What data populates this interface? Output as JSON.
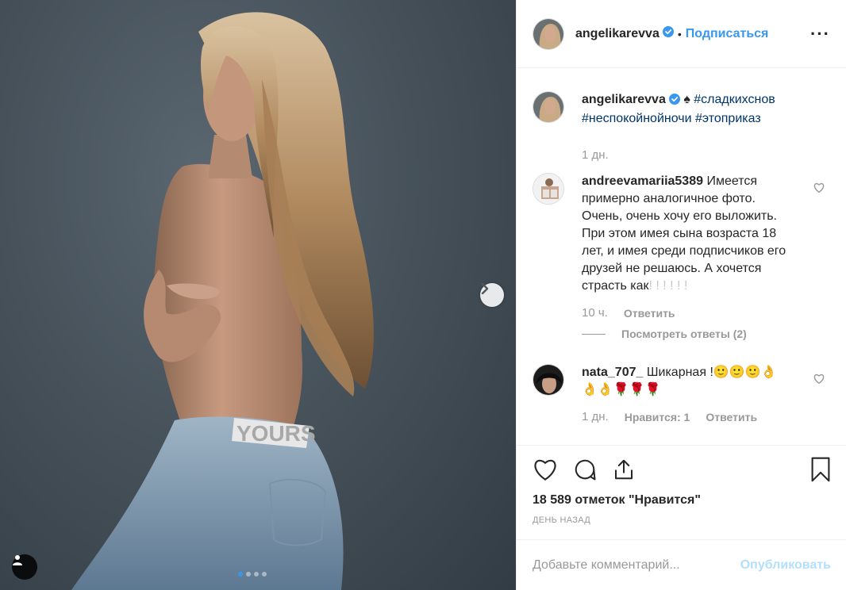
{
  "post": {
    "author": "angelikarevva",
    "follow_label": "Подписаться",
    "separator": "•",
    "more_label": "···",
    "photo_waist_text": "YOURS",
    "carousel_count": 4,
    "carousel_active": 1
  },
  "caption": {
    "username": "angelikarevva",
    "text_symbol": "♠",
    "hashtags": [
      "#сладкихснов",
      "#неспокойнойночи",
      "#этоприказ"
    ],
    "time": "1 дн."
  },
  "comments": [
    {
      "username": "andreevamariia5389",
      "text": "Имеется примерно аналогичное фото. Очень, очень хочу его выложить. При этом имея сына возраста 18 лет, и имея среди подписчиков его друзей не решаюсь. А хочется страсть как",
      "cut_text": "! ! ! ! ! !",
      "time": "10 ч.",
      "reply_label": "Ответить",
      "view_replies": "Посмотреть ответы (2)"
    },
    {
      "username": "nata_707_",
      "text": "Шикарная !🙂🙂🙂👌👌👌🌹🌹🌹",
      "time": "1 дн.",
      "likes_label": "Нравится: 1",
      "reply_label": "Ответить"
    }
  ],
  "actions": {
    "likes_text": "18 589 отметок \"Нравится\"",
    "date": "ДЕНЬ НАЗАД"
  },
  "add_comment": {
    "placeholder": "Добавьте комментарий...",
    "publish_label": "Опубликовать"
  },
  "colors": {
    "accent": "#3897f0",
    "hashtag": "#003569",
    "muted": "#999999",
    "publish_disabled": "#b2dffc"
  },
  "icons": [
    "person-tag-icon",
    "chevron-right-icon",
    "verified-badge-icon",
    "more-icon",
    "heart-icon",
    "comment-icon",
    "share-icon",
    "bookmark-icon"
  ]
}
